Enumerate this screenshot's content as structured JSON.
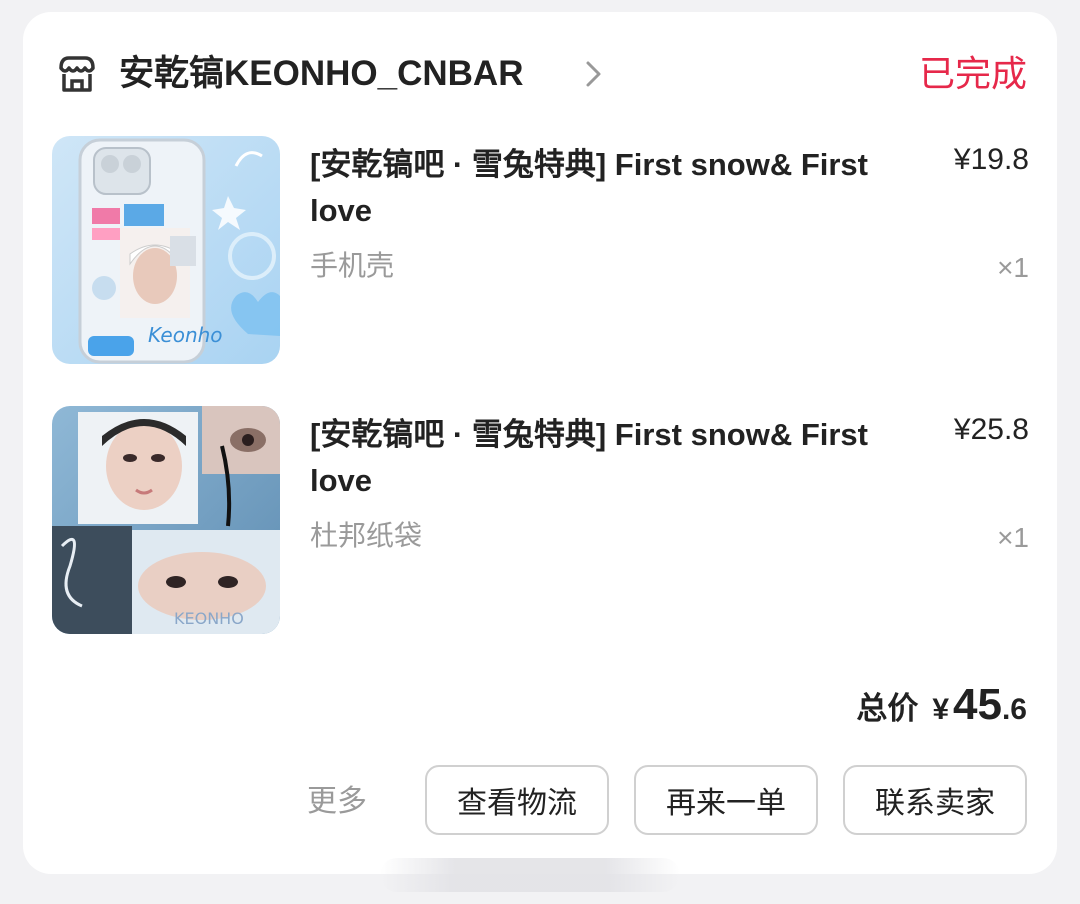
{
  "shop": {
    "name": "安乾镐KEONHO_CNBAR",
    "status": "已完成"
  },
  "items": [
    {
      "title": "[安乾镐吧 · 雪兔特典] First snow& First love",
      "spec": "手机壳",
      "price": "¥19.8",
      "qty": "×1",
      "thumb_text": "Keonho"
    },
    {
      "title": "[安乾镐吧 · 雪兔特典] First snow& First love",
      "spec": "杜邦纸袋",
      "price": "¥25.8",
      "qty": "×1",
      "thumb_text": "KEONHO"
    }
  ],
  "total": {
    "label": "总价",
    "currency": "¥",
    "integer": "45",
    "decimal": ".6"
  },
  "actions": {
    "more": "更多",
    "logistics": "查看物流",
    "reorder": "再来一单",
    "contact": "联系卖家"
  },
  "colors": {
    "status": "#e6284a",
    "text": "#222222",
    "muted": "#9a9a9a",
    "border": "#d0d0d0"
  }
}
